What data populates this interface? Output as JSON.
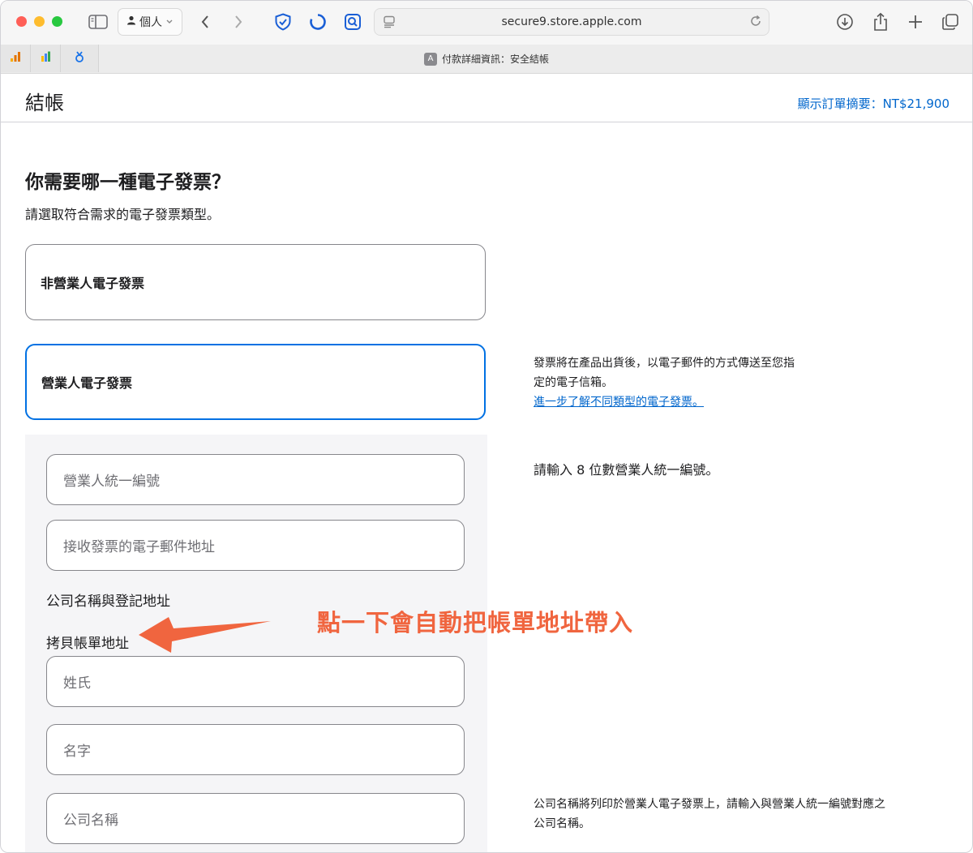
{
  "browser": {
    "profile_label": "個人",
    "url": "secure9.store.apple.com",
    "tab_title": "付款詳細資訊：安全結帳",
    "tab_favicon_letter": "A"
  },
  "header": {
    "title": "結帳",
    "summary_link": "顯示訂單摘要：NT$21,900"
  },
  "invoice": {
    "heading": "你需要哪一種電子發票？",
    "subheading": "請選取符合需求的電子發票類型。",
    "options": [
      {
        "label": "非營業人電子發票",
        "selected": false
      },
      {
        "label": "營業人電子發票",
        "selected": true
      }
    ],
    "info_line1": "發票將在產品出貨後，以電子郵件的方式傳送至您指",
    "info_line2": "定的電子信箱。",
    "info_link": "進一步了解不同類型的電子發票。"
  },
  "form": {
    "tax_id_placeholder": "營業人統一編號",
    "tax_id_hint": "請輸入 8 位數營業人統一編號。",
    "email_placeholder": "接收發票的電子郵件地址",
    "company_section_label": "公司名稱與登記地址",
    "copy_billing_link": "拷貝帳單地址",
    "last_name_placeholder": "姓氏",
    "first_name_placeholder": "名字",
    "company_placeholder": "公司名稱",
    "company_hint_line1": "公司名稱將列印於營業人電子發票上，請輸入與營業人統一編號對應之",
    "company_hint_line2": "公司名稱。"
  },
  "annotation": {
    "text": "點一下會自動把帳單地址帶入",
    "color": "#f0653f"
  },
  "colors": {
    "accent": "#0071e3",
    "link": "#0066cc",
    "panel_bg": "#f5f5f7"
  }
}
